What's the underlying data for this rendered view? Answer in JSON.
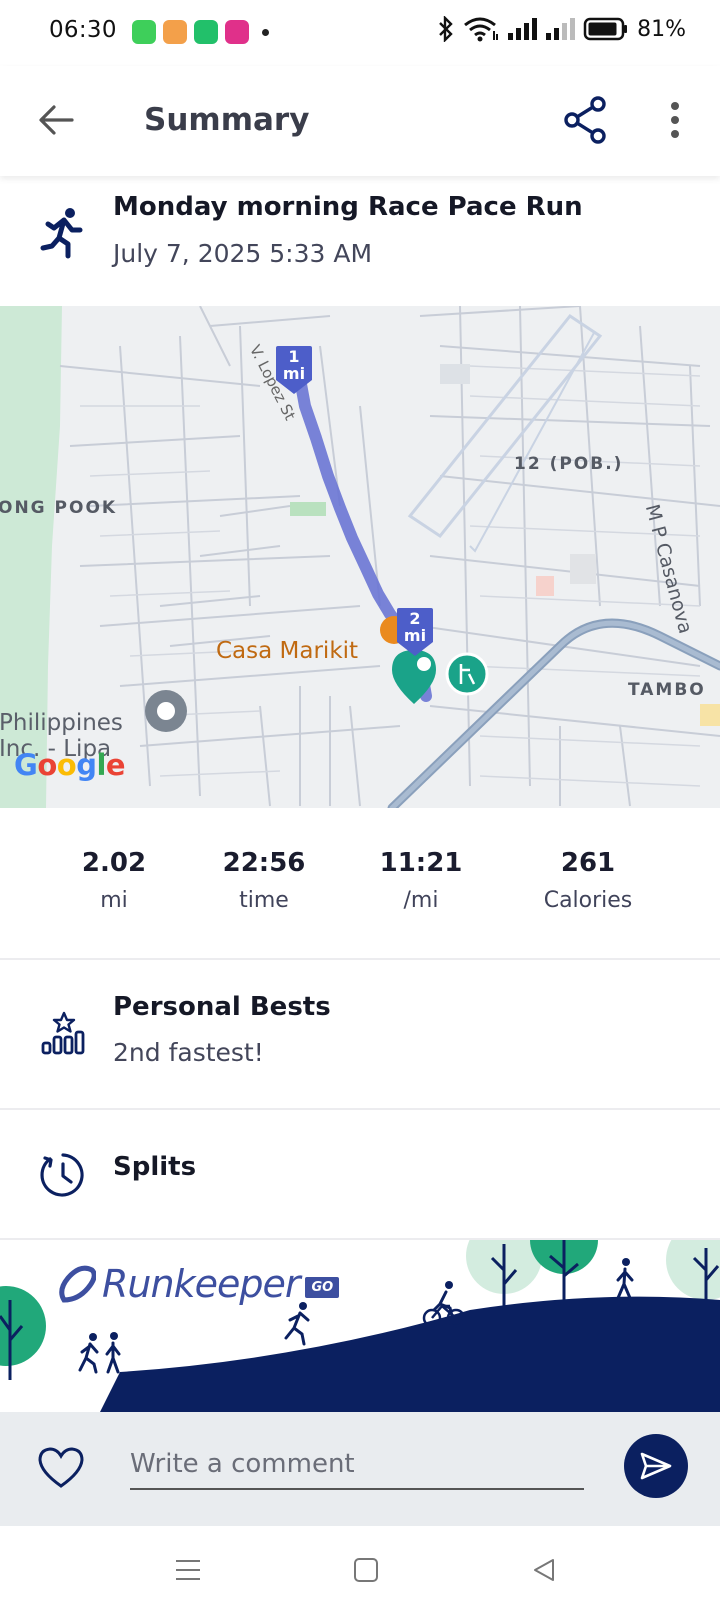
{
  "status_bar": {
    "time": "06:30",
    "battery": "81%",
    "app_icons": [
      {
        "name": "android-app-icon",
        "color": "#3ecf5a"
      },
      {
        "name": "game-app-icon",
        "color": "#f06a2a"
      },
      {
        "name": "green-app-icon",
        "color": "#22c06a"
      },
      {
        "name": "lazada-app-icon",
        "color": "#e0308a"
      }
    ]
  },
  "app_bar": {
    "title": "Summary"
  },
  "activity": {
    "title": "Monday morning Race Pace Run",
    "date": "July 7, 2025 5:33 AM"
  },
  "map": {
    "labels": {
      "pook": "ONG POOK",
      "pob": "12 (POB.)",
      "tambo": "TAMBO",
      "casa": "Casa Marikit",
      "philippines_line1": "Philippines",
      "philippines_line2": "Inc. - Lipa",
      "casanova": "M P Casanova",
      "street": "V. Lopez St",
      "google": [
        "G",
        "o",
        "o",
        "g",
        "l",
        "e"
      ]
    },
    "markers": [
      {
        "num": "1",
        "unit": "mi"
      },
      {
        "num": "2",
        "unit": "mi"
      }
    ],
    "colors": {
      "route": "#5f6fd0",
      "marker": "#4d5ec9",
      "finish": "#1aa389"
    }
  },
  "stats": [
    {
      "value": "2.02",
      "unit": "mi"
    },
    {
      "value": "22:56",
      "unit": "time"
    },
    {
      "value": "11:21",
      "unit": "/mi"
    },
    {
      "value": "261",
      "unit": "Calories"
    }
  ],
  "personal_bests": {
    "title": "Personal Bests",
    "subtitle": "2nd fastest!"
  },
  "splits": {
    "title": "Splits"
  },
  "banner": {
    "brand": "Runkeeper",
    "badge": "GO"
  },
  "comment": {
    "placeholder": "Write a comment"
  },
  "colors": {
    "brand_navy": "#0b2060",
    "accent_blue": "#3d4fa0"
  }
}
